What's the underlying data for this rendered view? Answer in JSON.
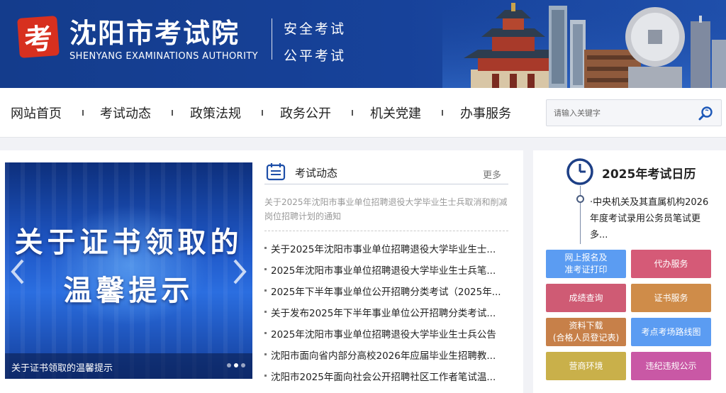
{
  "header": {
    "seal_char": "考",
    "title": "沈阳市考试院",
    "subtitle": "SHENYANG EXAMINATIONS AUTHORITY",
    "slogan_1": "安全考试",
    "slogan_2": "公平考试"
  },
  "nav": {
    "items": [
      "网站首页",
      "考试动态",
      "政策法规",
      "政务公开",
      "机关党建",
      "办事服务"
    ],
    "search_placeholder": "请输入关键字"
  },
  "banner": {
    "line_1": "关于证书领取的",
    "line_2": "温馨提示",
    "caption": "关于证书领取的温馨提示",
    "slide_count": 3,
    "active_slide": 2
  },
  "news": {
    "title": "考试动态",
    "more": "更多",
    "featured": "关于2025年沈阳市事业单位招聘退役大学毕业生士兵取消和削减岗位招聘计划的通知",
    "items": [
      "关于2025年沈阳市事业单位招聘退役大学毕业生士...",
      "2025年沈阳市事业单位招聘退役大学毕业生士兵笔...",
      "2025年下半年事业单位公开招聘分类考试（2025年...",
      "关于发布2025年下半年事业单位公开招聘分类考试...",
      "2025年沈阳市事业单位招聘退役大学毕业生士兵公告",
      "沈阳市面向省内部分高校2026年应届毕业生招聘教...",
      "沈阳市2025年面向社会公开招聘社区工作者笔试温..."
    ]
  },
  "calendar": {
    "title": "2025年考试日历",
    "entry": "·中央机关及其直属机构2026年度考试录用公务员笔试更多..."
  },
  "services": [
    {
      "label": "网上报名及\n准考证打印",
      "color": "#5b9cf2"
    },
    {
      "label": "代办服务",
      "color": "#d55a77"
    },
    {
      "label": "成绩查询",
      "color": "#cf5b74"
    },
    {
      "label": "证书服务",
      "color": "#cf8c49"
    },
    {
      "label": "资料下载\n(合格人员登记表)",
      "color": "#c78049"
    },
    {
      "label": "考点考场路线图",
      "color": "#5b9cf2"
    },
    {
      "label": "营商环境",
      "color": "#c9b04a"
    },
    {
      "label": "违纪违规公示",
      "color": "#c958a5"
    }
  ],
  "colors": {
    "header_bg": "#17429a",
    "accent_blue": "#2b6ee0"
  }
}
